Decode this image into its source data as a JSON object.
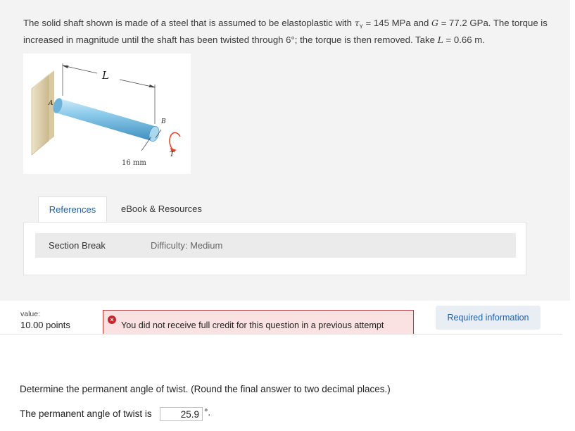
{
  "problem": {
    "p1": "The solid shaft shown is made of a steel that is assumed to be elastoplastic with ",
    "tau": "τ",
    "tau_sub": "Y",
    "p2": " = 145 MPa and ",
    "g": "G",
    "p3": " = 77.2 GPa. The torque is increased in magnitude until the shaft has been twisted through 6°; the torque is then removed. Take ",
    "l": "L",
    "p4": " = 0.66 m."
  },
  "figure": {
    "label_L": "L",
    "label_A": "A",
    "label_B": "B",
    "label_T": "T",
    "label_diameter": "16 mm"
  },
  "tabs": {
    "references": "References",
    "ebook": "eBook & Resources"
  },
  "resources": {
    "section_break": "Section Break",
    "difficulty": "Difficulty: Medium"
  },
  "score": {
    "value_label": "value:",
    "points": "10.00 points"
  },
  "alert": {
    "icon": "×",
    "icon_name": "error-icon",
    "text": "You did not receive full credit for this question in a previous attempt"
  },
  "required_button": "Required information",
  "question": {
    "prompt": "Determine the permanent angle of twist. (Round the final answer to two decimal places.)",
    "answer_label": "The permanent angle of twist is",
    "answer_value": "25.9",
    "answer_unit": "°."
  },
  "colors": {
    "link": "#1f5fa8",
    "alert_bg": "#fbe2e2",
    "alert_border": "#b23a3a",
    "shaft": "#7ec4e6"
  }
}
